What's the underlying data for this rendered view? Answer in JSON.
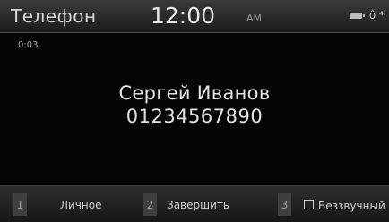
{
  "header": {
    "title": "Телефон",
    "time": "12:00",
    "ampm": "AM",
    "status_icons": [
      "battery-icon",
      "bluetooth-phone-icon",
      "signal-icon"
    ],
    "status_text": "ô ⁴ⁱ"
  },
  "call": {
    "timer": "0:03",
    "contact_name": "Сергей Иванов",
    "phone_number": "01234567890"
  },
  "softkeys": [
    {
      "number": "1",
      "label": "Личное"
    },
    {
      "number": "2",
      "label": "Завершить"
    },
    {
      "number": "3",
      "label": "Беззвучный"
    }
  ],
  "colors": {
    "background": "#050505",
    "header": "#2a2a2a",
    "text": "#e4e4e4"
  }
}
